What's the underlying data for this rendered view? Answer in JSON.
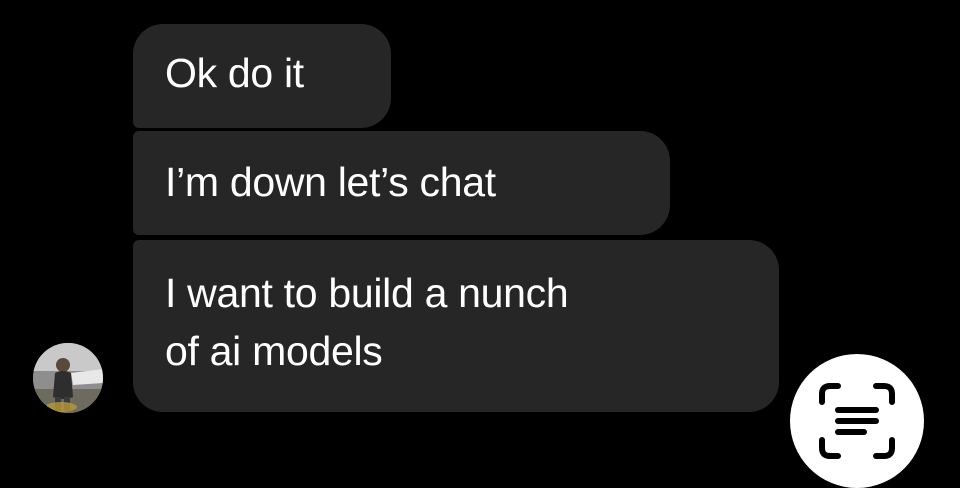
{
  "messages": [
    {
      "text": "Ok do it"
    },
    {
      "text": "I’m down let’s chat"
    },
    {
      "line1": "I want to build a nunch",
      "line2": "of ai models"
    }
  ],
  "avatar": {
    "icon": "profile-photo"
  },
  "action_button": {
    "icon": "live-text-scan-icon"
  }
}
